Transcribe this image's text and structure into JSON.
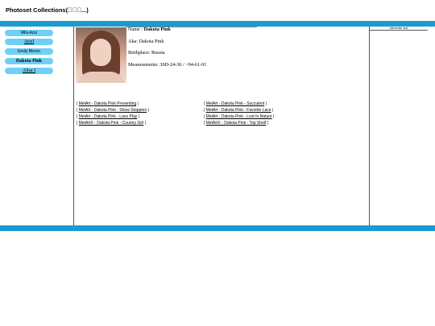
{
  "header": {
    "title": "Photoset Collections(\u0000\u0000\u0000...)"
  },
  "sidebar": {
    "items": [
      {
        "label": "Mila Azul"
      },
      {
        "label": "Ariel"
      },
      {
        "label": "Emily Bloom"
      },
      {
        "label": "Dakota Pink"
      },
      {
        "label": "Alisa I"
      }
    ]
  },
  "profile": {
    "name_label": "Name :",
    "name": "Dakota Pink",
    "aka": "Aka: Dakota Pink",
    "birthplace": "Birthplace: Russia",
    "measurements": "Measurements: 36D-24-36 / ~94-61-91"
  },
  "links": {
    "left": [
      "MetArt - Dakota Pink Presenting",
      "MetArt - Dakota Pink - Show Stoppers",
      "MetArt - Dakota Pink - Lace Play",
      "MetArtX - Dakota Pink - Country Girl"
    ],
    "right": [
      "MetArt - Dakota Pink - Succulent",
      "MetArt - Dakota Pink - Favorite Lace",
      "MetArt - Dakota Pink - Lost In Nature",
      "MetArtX - Dakota Pink - Top Shelf"
    ]
  },
  "advert": {
    "label": "Advertise slot"
  },
  "colors": {
    "accent_bar": "#1a9bd0",
    "sidebar_button": "#6fd0f5"
  }
}
